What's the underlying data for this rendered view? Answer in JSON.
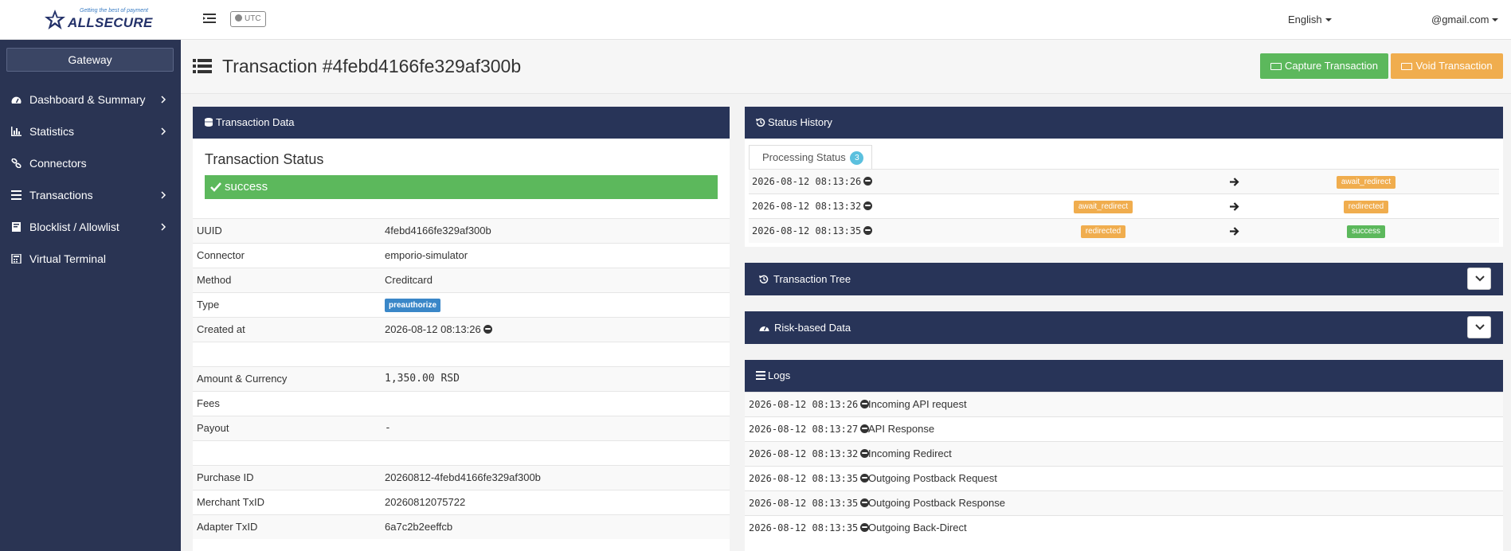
{
  "header": {
    "logo_tagline": "Getting the best of payment",
    "logo_word": "ALLSECURE",
    "timezone": "UTC",
    "language": "English",
    "user": "@gmail.com"
  },
  "sidebar": {
    "gateway_label": "Gateway",
    "items": [
      {
        "label": "Dashboard & Summary",
        "icon": "dashboard-icon",
        "has_submenu": true
      },
      {
        "label": "Statistics",
        "icon": "bar-chart-icon",
        "has_submenu": true
      },
      {
        "label": "Connectors",
        "icon": "link-icon",
        "has_submenu": false
      },
      {
        "label": "Transactions",
        "icon": "list-icon",
        "has_submenu": true
      },
      {
        "label": "Blocklist / Allowlist",
        "icon": "book-icon",
        "has_submenu": true
      },
      {
        "label": "Virtual Terminal",
        "icon": "calculator-icon",
        "has_submenu": false
      }
    ]
  },
  "page": {
    "title": "Transaction #4febd4166fe329af300b",
    "capture_label": "Capture Transaction",
    "void_label": "Void Transaction"
  },
  "transaction_data": {
    "panel_title": "Transaction Data",
    "status_title": "Transaction Status",
    "status_value": "success",
    "rows": [
      {
        "key": "UUID",
        "value": "4febd4166fe329af300b"
      },
      {
        "key": "Connector",
        "value": "emporio-simulator"
      },
      {
        "key": "Method",
        "value": "Creditcard"
      },
      {
        "key": "Type",
        "value": "preauthorize"
      },
      {
        "key": "Created at",
        "value": "2026-08-12 08:13:26"
      },
      {
        "key": "",
        "value": ""
      },
      {
        "key": "Amount & Currency",
        "value": "1,350.00 RSD"
      },
      {
        "key": "Fees",
        "value": ""
      },
      {
        "key": "Payout",
        "value": "-"
      },
      {
        "key": "",
        "value": ""
      },
      {
        "key": "Purchase ID",
        "value": "20260812-4febd4166fe329af300b"
      },
      {
        "key": "Merchant TxID",
        "value": "20260812075722"
      },
      {
        "key": "Adapter TxID",
        "value": "6a7c2b2eeffcb"
      }
    ]
  },
  "status_history": {
    "panel_title": "Status History",
    "tab_label": "Processing Status",
    "tab_count": "3",
    "rows": [
      {
        "timestamp": "2026-08-12 08:13:26",
        "from": "",
        "to": "await_redirect",
        "to_color": "#f0ad4e"
      },
      {
        "timestamp": "2026-08-12 08:13:32",
        "from": "await_redirect",
        "to": "redirected",
        "to_color": "#f0ad4e"
      },
      {
        "timestamp": "2026-08-12 08:13:35",
        "from": "redirected",
        "to": "success",
        "to_color": "#5cb85c"
      }
    ]
  },
  "transaction_tree": {
    "panel_title": "Transaction Tree"
  },
  "risk_data": {
    "panel_title": "Risk-based Data"
  },
  "logs": {
    "panel_title": "Logs",
    "rows": [
      {
        "timestamp": "2026-08-12 08:13:26",
        "message": "Incoming API request"
      },
      {
        "timestamp": "2026-08-12 08:13:27",
        "message": "API Response"
      },
      {
        "timestamp": "2026-08-12 08:13:32",
        "message": "Incoming Redirect"
      },
      {
        "timestamp": "2026-08-12 08:13:35",
        "message": "Outgoing Postback Request"
      },
      {
        "timestamp": "2026-08-12 08:13:35",
        "message": "Outgoing Postback Response"
      },
      {
        "timestamp": "2026-08-12 08:13:35",
        "message": "Outgoing Back-Direct"
      }
    ]
  },
  "colors": {
    "sidebar_bg": "#2a3453",
    "panel_header": "#283458",
    "success": "#5cb85c",
    "warning": "#f0ad4e",
    "info": "#3a87c8"
  }
}
